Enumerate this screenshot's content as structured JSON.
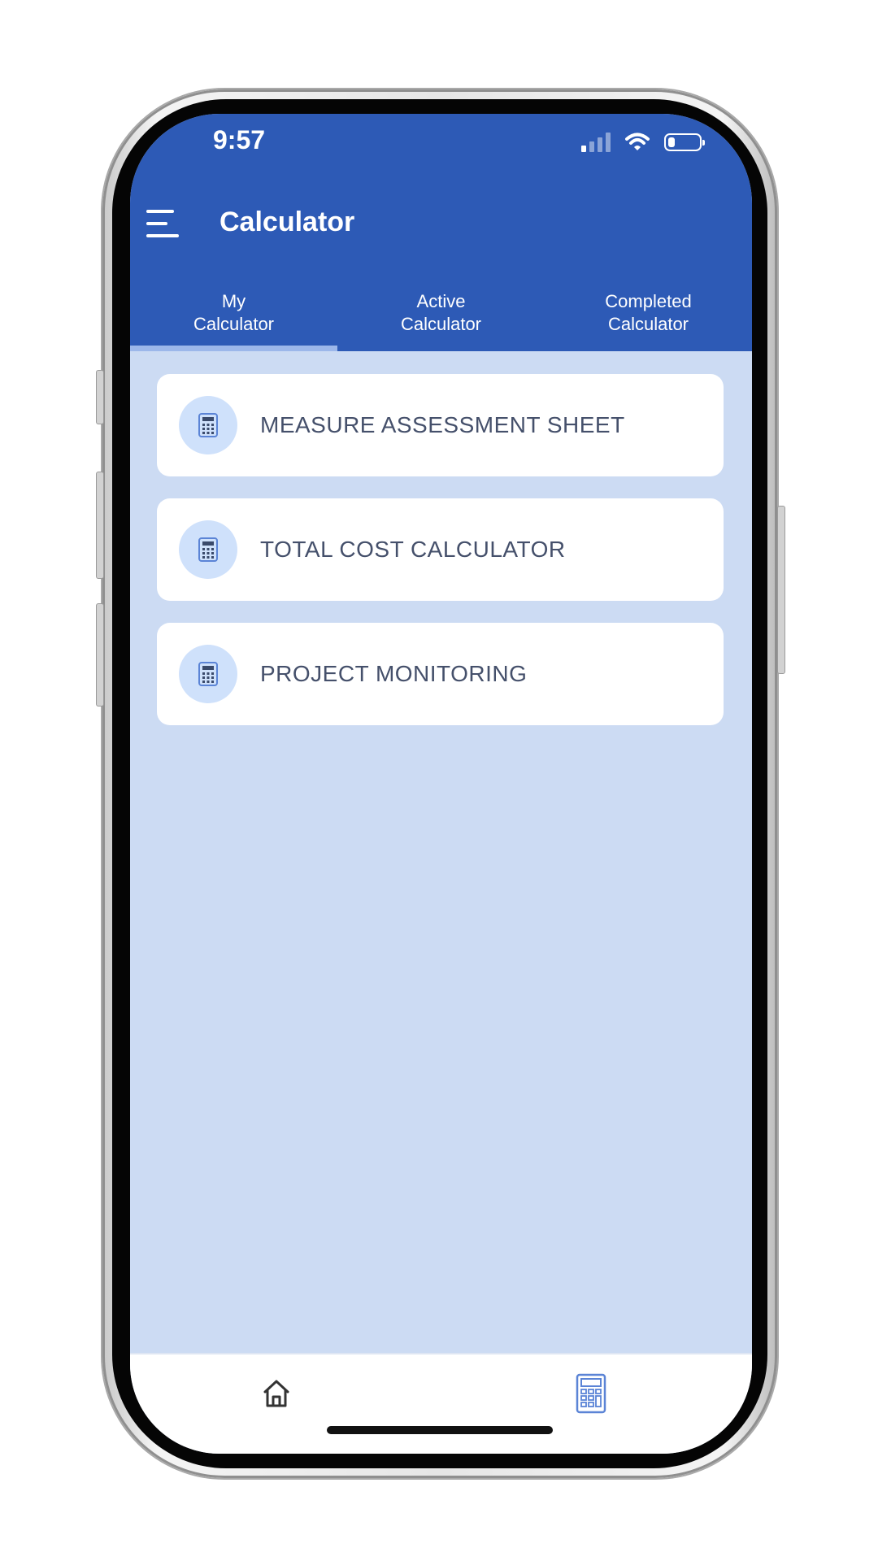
{
  "status_bar": {
    "time": "9:57",
    "icons": [
      "cellular-signal-icon",
      "wifi-icon",
      "battery-icon"
    ]
  },
  "header": {
    "menu_icon": "hamburger-menu-icon",
    "title": "Calculator"
  },
  "tabs": [
    {
      "line1": "My",
      "line2": "Calculator",
      "active": true
    },
    {
      "line1": "Active",
      "line2": "Calculator",
      "active": false
    },
    {
      "line1": "Completed",
      "line2": "Calculator",
      "active": false
    }
  ],
  "cards": [
    {
      "icon": "calculator-icon",
      "label": "MEASURE ASSESSMENT SHEET"
    },
    {
      "icon": "calculator-icon",
      "label": "TOTAL COST CALCULATOR"
    },
    {
      "icon": "calculator-icon",
      "label": "PROJECT MONITORING"
    }
  ],
  "bottom_nav": [
    {
      "icon": "home-icon",
      "active": false
    },
    {
      "icon": "calculator-icon",
      "active": true
    }
  ],
  "colors": {
    "header_bg": "#2d5ab6",
    "content_bg": "#ccdbf3",
    "tab_indicator": "#9cb7ea",
    "card_text": "#45506b",
    "icon_circle": "#cfe1fb",
    "icon_accent": "#5b84d6"
  }
}
